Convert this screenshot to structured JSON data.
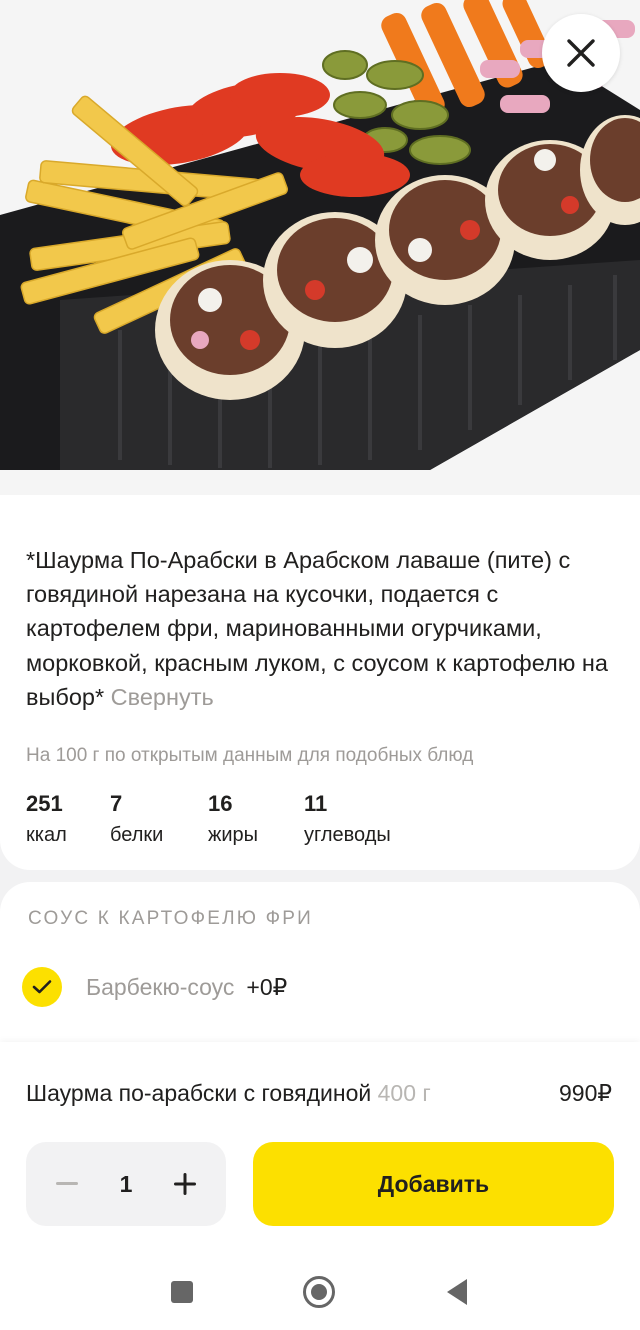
{
  "close_icon": "close-icon",
  "description": {
    "text": "*Шаурма По-Арабски в Арабском лаваше (пите) с говядиной нарезана на кусочки, подается с картофелем фри, маринованными огурчиками, морковкой, красным луком, с соусом к картофелю на выбор*",
    "collapse_label": "Свернуть"
  },
  "nutrition": {
    "note": "На 100 г по открытым данным для подобных блюд",
    "items": [
      {
        "value": "251",
        "label": "ккал"
      },
      {
        "value": "7",
        "label": "белки"
      },
      {
        "value": "16",
        "label": "жиры"
      },
      {
        "value": "11",
        "label": "углеводы"
      }
    ]
  },
  "sauce_section": {
    "title": "СОУС К КАРТОФЕЛЮ ФРИ",
    "option": {
      "name": "Барбекю-соус",
      "price": "+0₽",
      "selected": true
    }
  },
  "product": {
    "name": "Шаурма по-арабски с говядиной",
    "weight": "400 г",
    "price": "990₽"
  },
  "stepper": {
    "quantity": "1"
  },
  "add_button_label": "Добавить",
  "colors": {
    "accent": "#fce000",
    "text": "#21201f",
    "muted": "#9e9b98"
  }
}
